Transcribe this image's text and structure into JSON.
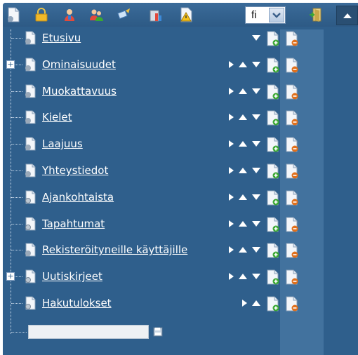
{
  "toolbar": {
    "icons": [
      "new-page-icon",
      "lock-icon",
      "user-icon",
      "users-icon",
      "brush-icon",
      "stats-icon",
      "warning-icon",
      "exit-icon",
      "collapse-icon"
    ],
    "language_value": "fi"
  },
  "tree": {
    "items": [
      {
        "label": "Etusivu",
        "expandable": false,
        "actions": [
          "down",
          "add",
          "delete"
        ]
      },
      {
        "label": "Ominaisuudet",
        "expandable": true,
        "actions": [
          "indent",
          "up",
          "down",
          "add",
          "delete"
        ]
      },
      {
        "label": "Muokattavuus",
        "expandable": false,
        "actions": [
          "indent",
          "up",
          "down",
          "add",
          "delete"
        ]
      },
      {
        "label": "Kielet",
        "expandable": false,
        "actions": [
          "indent",
          "up",
          "down",
          "add",
          "delete"
        ]
      },
      {
        "label": "Laajuus",
        "expandable": false,
        "actions": [
          "indent",
          "up",
          "down",
          "add",
          "delete"
        ]
      },
      {
        "label": "Yhteystiedot",
        "expandable": false,
        "actions": [
          "indent",
          "up",
          "down",
          "add",
          "delete"
        ]
      },
      {
        "label": "Ajankohtaista",
        "expandable": false,
        "actions": [
          "indent",
          "up",
          "down",
          "add",
          "delete"
        ]
      },
      {
        "label": "Tapahtumat",
        "expandable": false,
        "actions": [
          "indent",
          "up",
          "down",
          "add",
          "delete"
        ]
      },
      {
        "label": "Rekisteröityneille käyttäjille",
        "expandable": false,
        "actions": [
          "indent",
          "up",
          "down",
          "add",
          "delete"
        ]
      },
      {
        "label": "Uutiskirjeet",
        "expandable": true,
        "actions": [
          "indent",
          "up",
          "down",
          "add",
          "delete"
        ]
      },
      {
        "label": "Hakutulokset",
        "expandable": false,
        "actions": [
          "indent",
          "up",
          "add",
          "delete"
        ]
      }
    ],
    "new_page_value": ""
  },
  "colors": {
    "panel": "#2f5f8c",
    "toolbar": "#2d5a85",
    "label": "#ffffff",
    "add_badge": "#3aa832",
    "delete_badge": "#e0701c"
  }
}
